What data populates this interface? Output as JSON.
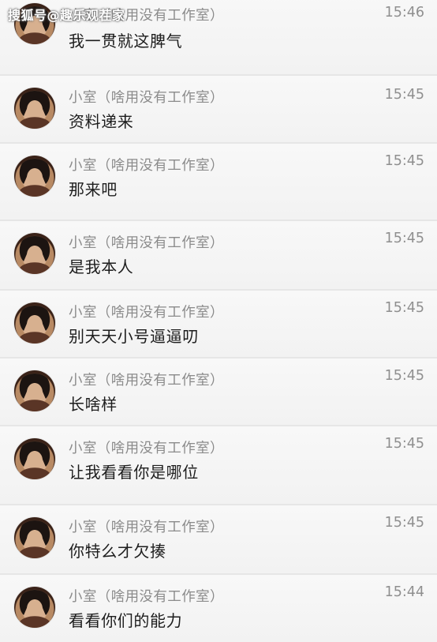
{
  "watermark": "搜狐号@趣乐观茬家",
  "messages": [
    {
      "sender": "小室（啥用没有工作室）",
      "time": "15:46",
      "text": "我一贯就这脾气"
    },
    {
      "sender": "小室（啥用没有工作室）",
      "time": "15:45",
      "text": "资料递来"
    },
    {
      "sender": "小室（啥用没有工作室）",
      "time": "15:45",
      "text": "那来吧"
    },
    {
      "sender": "小室（啥用没有工作室）",
      "time": "15:45",
      "text": "是我本人"
    },
    {
      "sender": "小室（啥用没有工作室）",
      "time": "15:45",
      "text": "别天天小号逼逼叨"
    },
    {
      "sender": "小室（啥用没有工作室）",
      "time": "15:45",
      "text": "长啥样"
    },
    {
      "sender": "小室（啥用没有工作室）",
      "time": "15:45",
      "text": "让我看看你是哪位"
    },
    {
      "sender": "小室（啥用没有工作室）",
      "time": "15:45",
      "text": "你特么才欠揍"
    },
    {
      "sender": "小室（啥用没有工作室）",
      "time": "15:44",
      "text": "看看你们的能力"
    }
  ]
}
